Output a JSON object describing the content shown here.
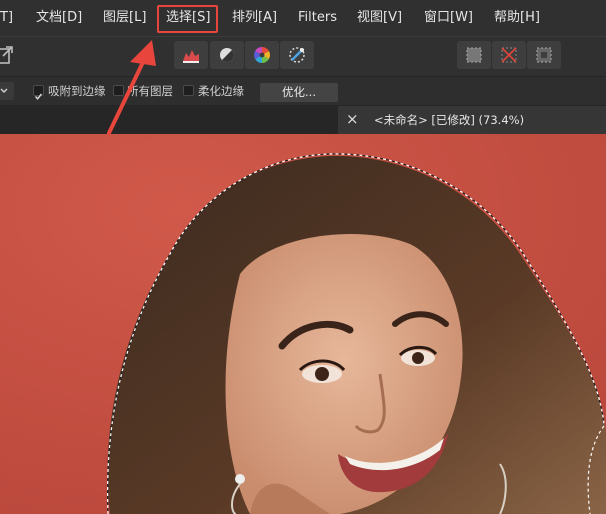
{
  "menubar": {
    "items": [
      {
        "label": "T]"
      },
      {
        "label": "文档[D]"
      },
      {
        "label": "图层[L]"
      },
      {
        "label": "选择[S]"
      },
      {
        "label": "排列[A]"
      },
      {
        "label": "Filters"
      },
      {
        "label": "视图[V]"
      },
      {
        "label": "窗口[W]"
      },
      {
        "label": "帮助[H]"
      }
    ],
    "highlighted_item": "选择[S]"
  },
  "toolbar": {
    "icons": [
      "export-icon",
      "levels-icon",
      "contrast-icon",
      "color-wheel-icon",
      "refine-selection-icon",
      "select-all-icon",
      "deselect-icon",
      "invert-selection-icon"
    ]
  },
  "context_toolbar": {
    "snap_label": "吸附到边缘",
    "snap_checked": true,
    "all_layers_label": "所有图层",
    "all_layers_checked": false,
    "soft_edges_label": "柔化边缘",
    "soft_edges_checked": false,
    "refine_label": "优化..."
  },
  "document_tab": {
    "close_glyph": "×",
    "title": "<未命名> [已修改] (73.4%)"
  },
  "colors": {
    "annotation": "#e8463c",
    "background_wall": "#c4503f"
  }
}
